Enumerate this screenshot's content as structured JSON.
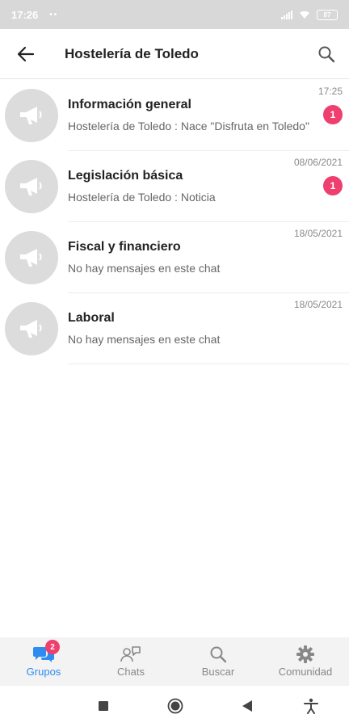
{
  "status_bar": {
    "time": "17:26",
    "dots": "••",
    "battery": "87"
  },
  "header": {
    "title": "Hostelería de Toledo"
  },
  "groups": [
    {
      "name": "Información general",
      "preview": "Hostelería de Toledo : Nace \"Disfruta en Toledo\"",
      "time": "17:25",
      "unread": "1"
    },
    {
      "name": "Legislación básica",
      "preview": "Hostelería de Toledo : Noticia",
      "time": "08/06/2021",
      "unread": "1"
    },
    {
      "name": "Fiscal y financiero",
      "preview": "No hay mensajes en este chat",
      "time": "18/05/2021",
      "unread": ""
    },
    {
      "name": "Laboral",
      "preview": "No hay mensajes en este chat",
      "time": "18/05/2021",
      "unread": ""
    }
  ],
  "bottom_nav": [
    {
      "label": "Grupos",
      "icon": "groups-icon",
      "badge": "2",
      "active": true
    },
    {
      "label": "Chats",
      "icon": "chats-icon",
      "active": false
    },
    {
      "label": "Buscar",
      "icon": "search-icon",
      "active": false
    },
    {
      "label": "Comunidad",
      "icon": "gear-icon",
      "active": false
    }
  ],
  "colors": {
    "accent": "#2e8cf0",
    "badge": "#ee3f6e",
    "avatar_bg": "#dcdcdc"
  }
}
